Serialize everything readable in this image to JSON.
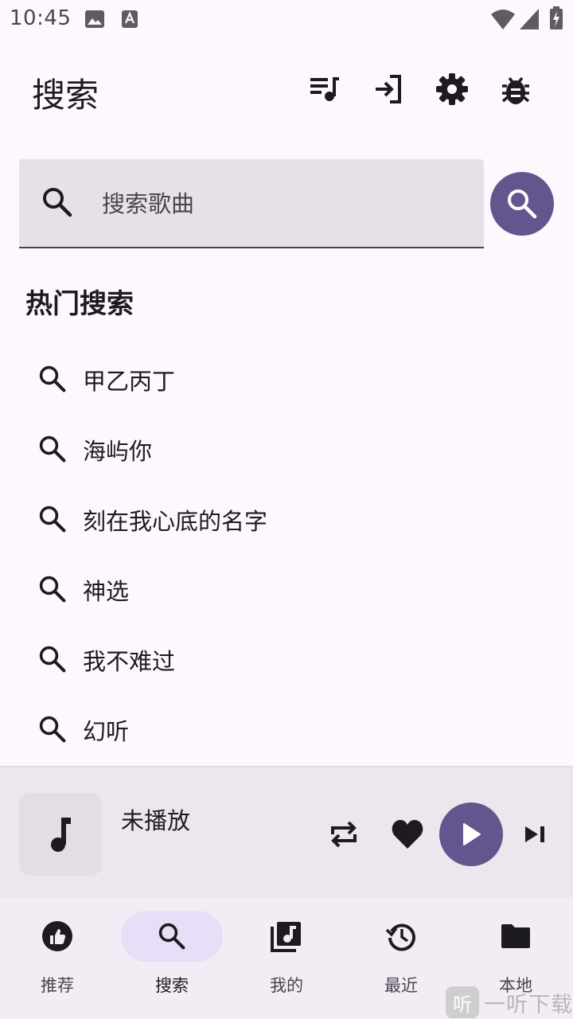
{
  "status_bar": {
    "time": "10:45"
  },
  "header": {
    "title": "搜索"
  },
  "search": {
    "placeholder": "搜索歌曲"
  },
  "hot": {
    "title": "热门搜索",
    "items": [
      "甲乙丙丁",
      "海屿你",
      "刻在我心底的名字",
      "神选",
      "我不难过",
      "幻听"
    ]
  },
  "player": {
    "title": "未播放"
  },
  "nav": {
    "items": [
      "推荐",
      "搜索",
      "我的",
      "最近",
      "本地"
    ],
    "active": 1
  },
  "watermark": {
    "badge": "听",
    "text": "一听下载"
  },
  "colors": {
    "accent": "#65558f",
    "nav_active_pill": "#e8def8",
    "background": "#fdf8fd"
  }
}
